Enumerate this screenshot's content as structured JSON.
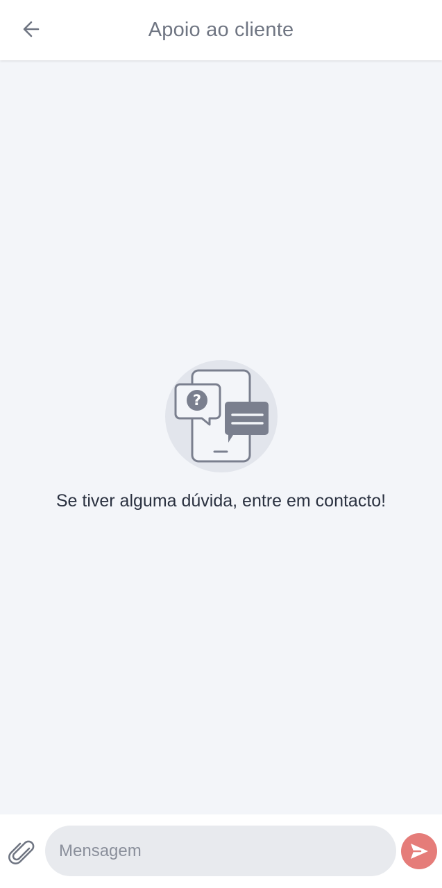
{
  "header": {
    "title": "Apoio ao cliente",
    "back_icon": "arrow-left-icon"
  },
  "empty_state": {
    "illustration_icon": "phone-chat-question-icon",
    "message": "Se tiver alguma dúvida, entre em contacto!"
  },
  "composer": {
    "attach_icon": "paperclip-icon",
    "input_placeholder": "Mensagem",
    "input_value": "",
    "send_icon": "send-icon"
  },
  "colors": {
    "background": "#f3f5f9",
    "header_bg": "#ffffff",
    "title_text": "#6f7582",
    "body_text": "#2a3140",
    "input_bg": "#e8eaee",
    "send_button": "#e57c79",
    "illustration_circle": "#e2e5ec",
    "illustration_stroke": "#7a7f8e"
  }
}
